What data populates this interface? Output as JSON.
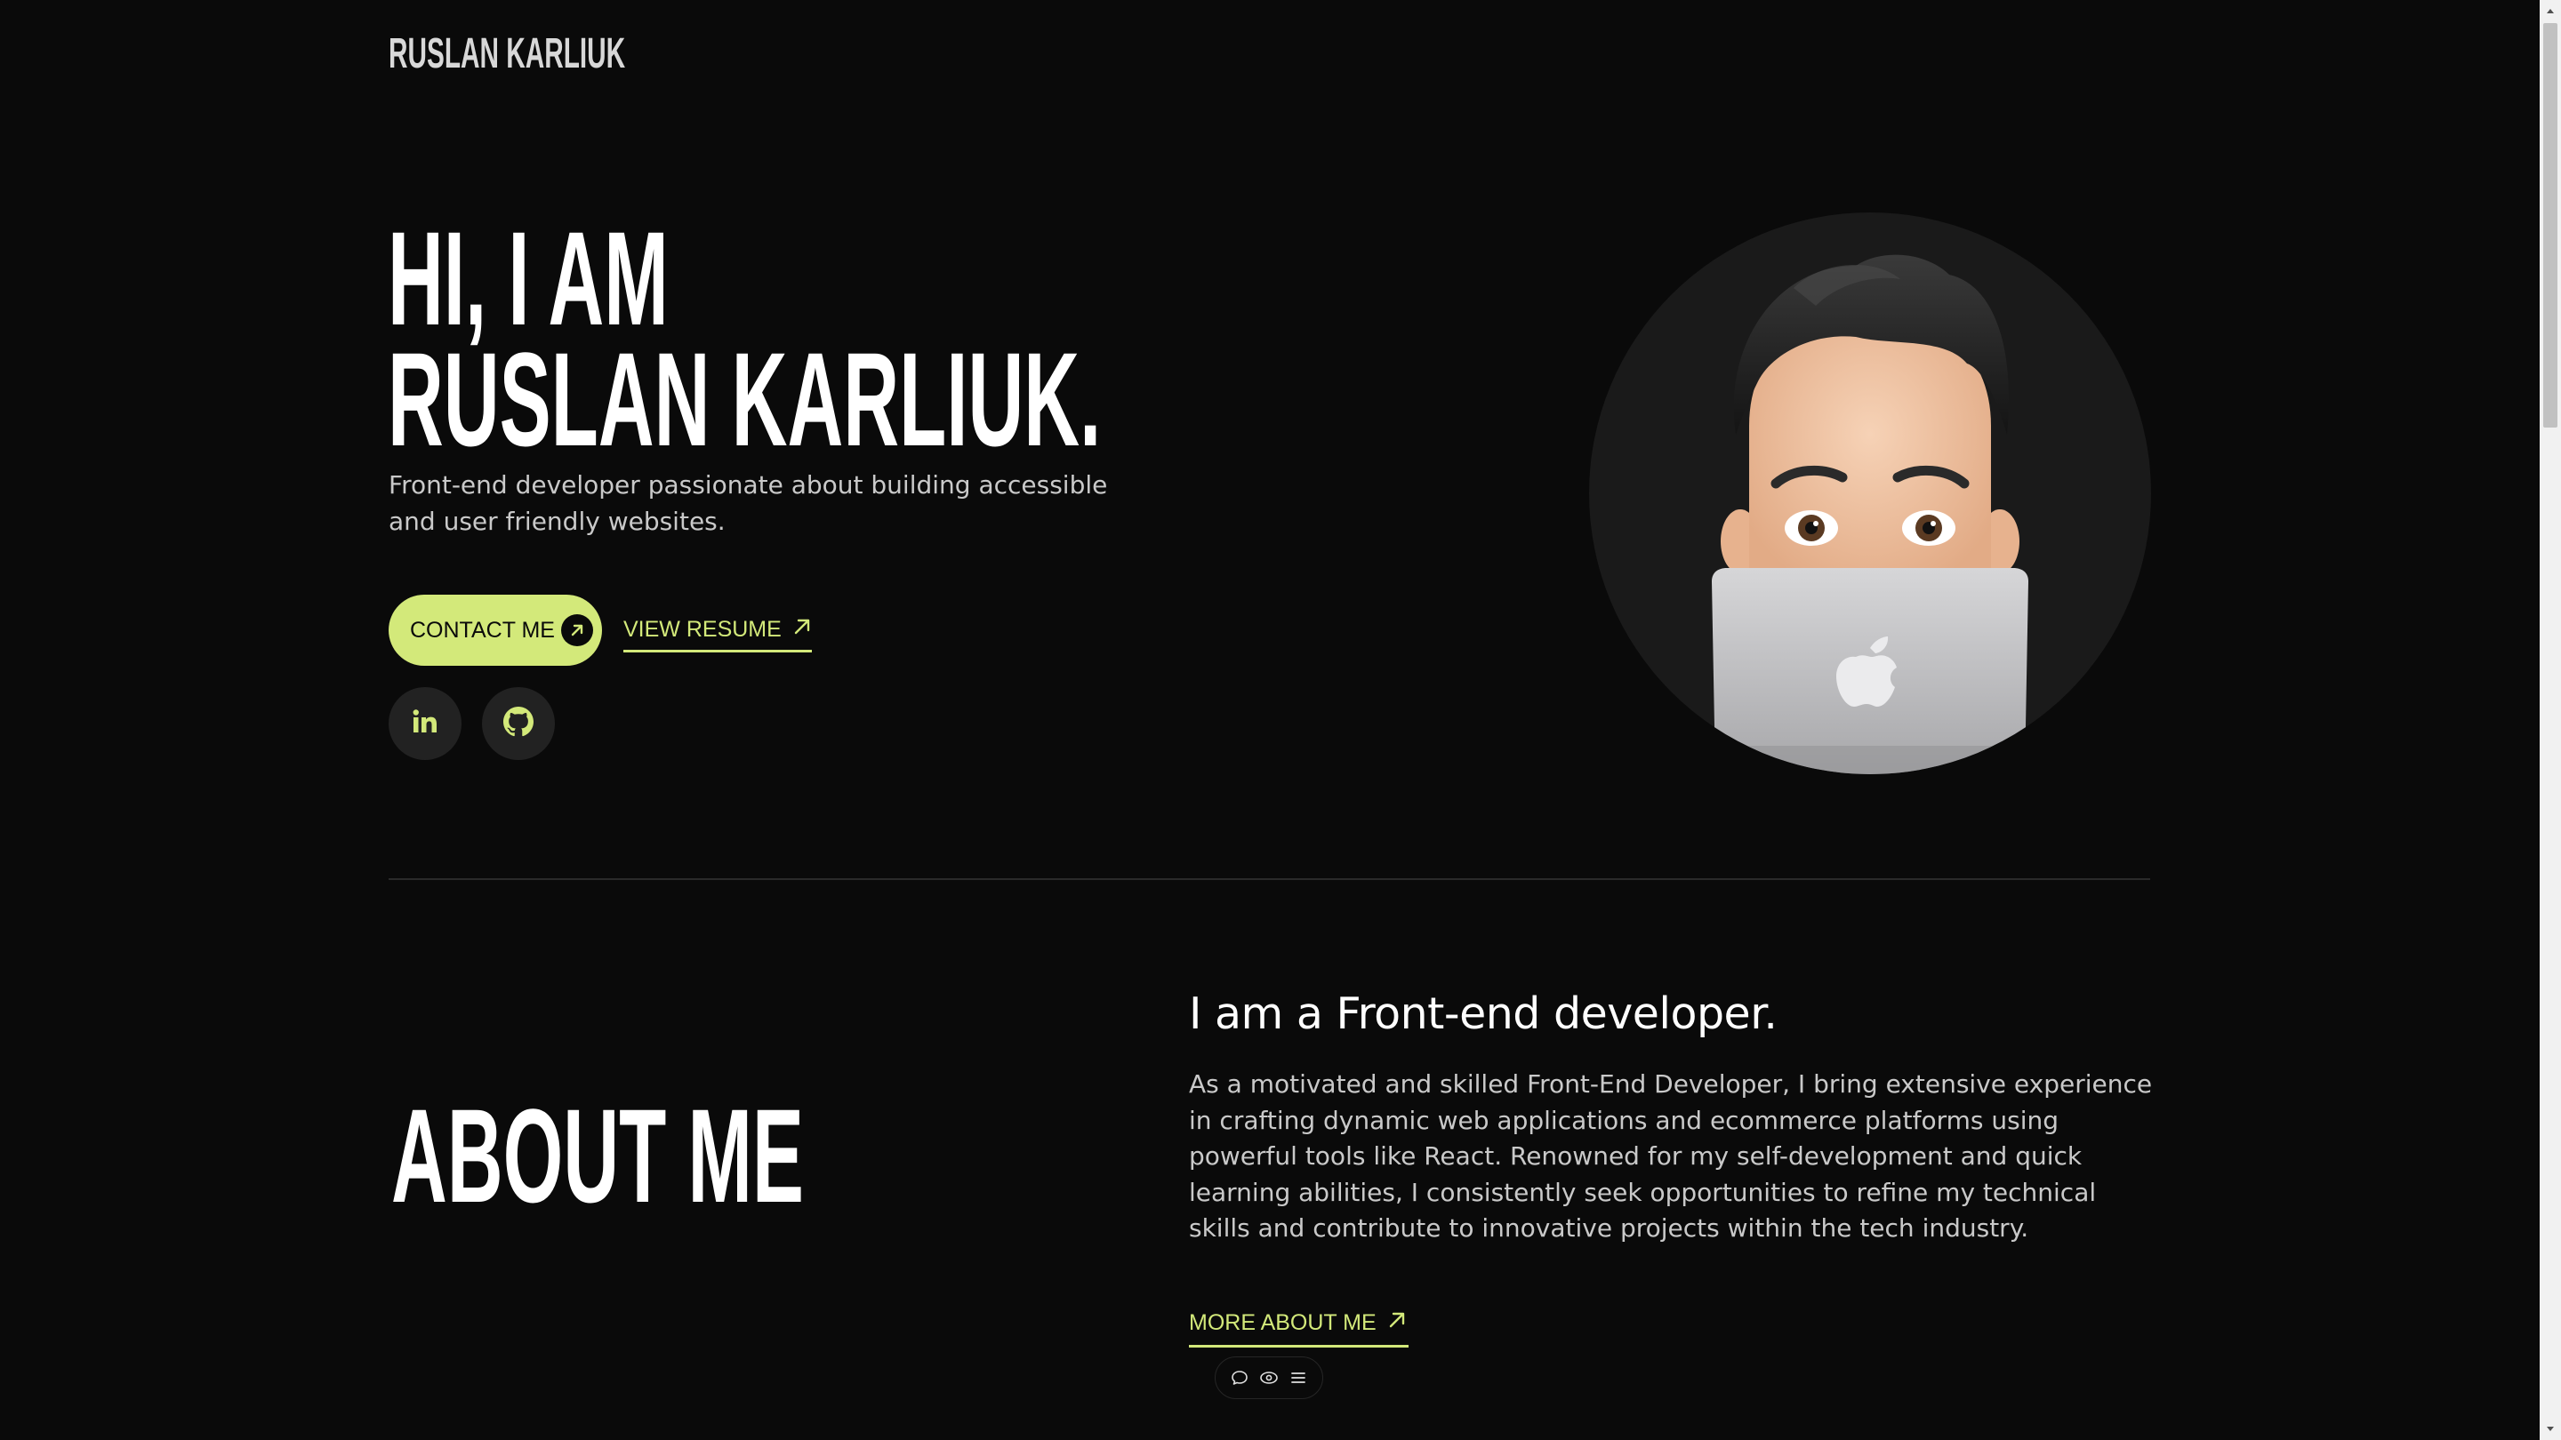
{
  "header": {
    "logo_text": "RUSLAN KARLIUK"
  },
  "hero": {
    "title_line1": "HI, I AM",
    "title_line2": "RUSLAN KARLIUK.",
    "subtitle": "Front-end developer passionate about building accessible and user friendly websites.",
    "contact_button_label": "CONTACT ME",
    "resume_link_label": "VIEW RESUME",
    "social_links": [
      {
        "name": "linkedin-icon"
      },
      {
        "name": "github-icon"
      }
    ],
    "avatar_icon": "memoji-avatar-with-laptop"
  },
  "about": {
    "section_title": "ABOUT ME",
    "heading": "I am a Front-end developer.",
    "paragraph": "As a motivated and skilled Front-End Developer, I bring extensive experience in crafting dynamic web applications and ecommerce platforms using powerful tools like React. Renowned for my self-development and quick learning abilities, I consistently seek opportunities to refine my technical skills and contribute to innovative projects within the tech industry.",
    "more_link_label": "MORE ABOUT ME"
  },
  "floating_toolbar": {
    "icons": [
      "comment-icon",
      "eye-icon",
      "menu-icon"
    ]
  },
  "colors": {
    "background": "#0a0a0a",
    "accent": "#d3e97a",
    "text_primary": "#ffffff",
    "text_secondary": "#c9c9c9",
    "surface": "#222222"
  }
}
